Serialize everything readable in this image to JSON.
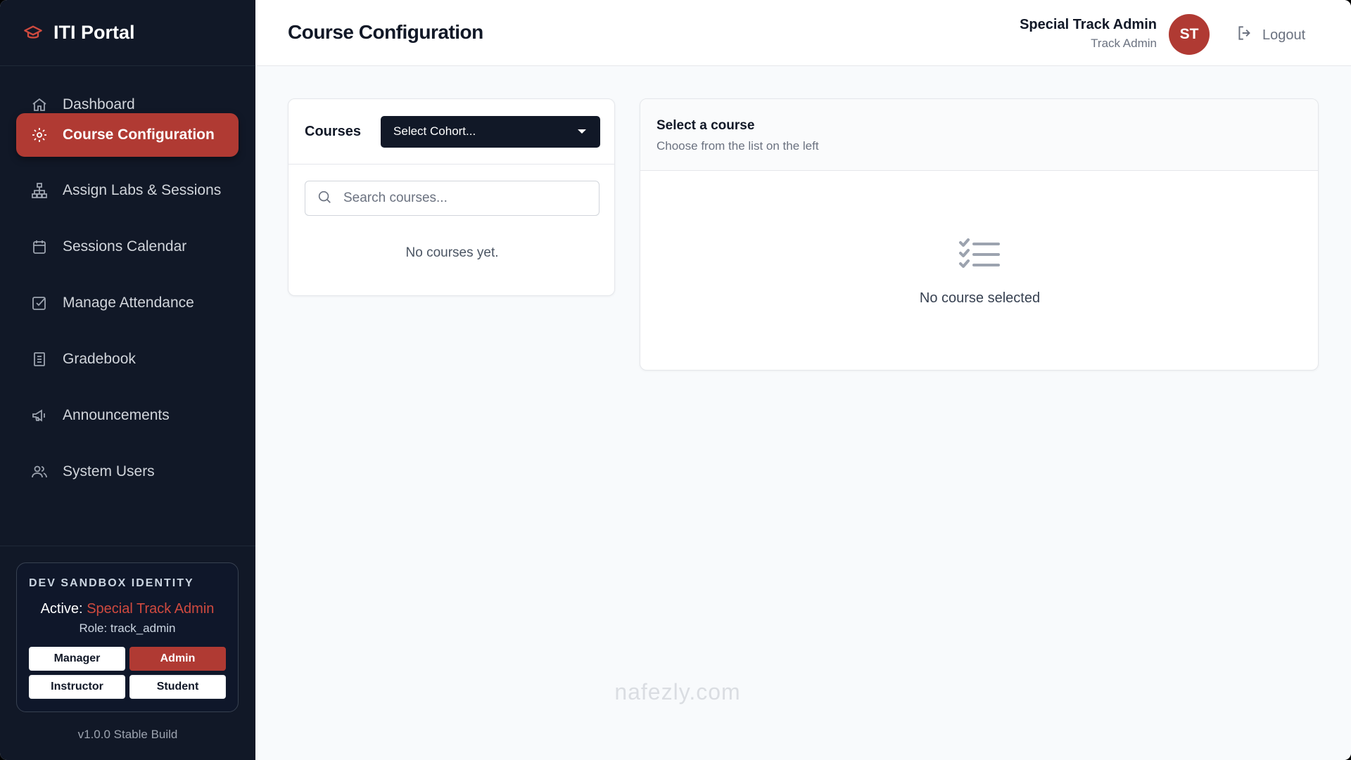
{
  "brand": {
    "title": "ITI Portal",
    "icon": "graduation-cap-icon"
  },
  "sidebar": {
    "items": [
      {
        "label": "Dashboard",
        "icon": "home-icon"
      },
      {
        "label": "Course Configuration",
        "icon": "gear-icon",
        "active": true
      },
      {
        "label": "Assign Labs & Sessions",
        "icon": "hierarchy-icon"
      },
      {
        "label": "Sessions Calendar",
        "icon": "calendar-icon"
      },
      {
        "label": "Manage Attendance",
        "icon": "check-square-icon"
      },
      {
        "label": "Gradebook",
        "icon": "book-icon"
      },
      {
        "label": "Announcements",
        "icon": "megaphone-icon"
      },
      {
        "label": "System Users",
        "icon": "users-icon"
      }
    ]
  },
  "sandbox": {
    "title": "DEV SANDBOX IDENTITY",
    "active_label": "Active:",
    "active_name": "Special Track Admin",
    "role_text": "Role: track_admin",
    "roles": [
      {
        "label": "Manager",
        "active": false
      },
      {
        "label": "Admin",
        "active": true
      },
      {
        "label": "Instructor",
        "active": false
      },
      {
        "label": "Student",
        "active": false
      }
    ]
  },
  "version": "v1.0.0 Stable Build",
  "header": {
    "title": "Course Configuration",
    "user_name": "Special Track Admin",
    "user_role": "Track Admin",
    "avatar_initials": "ST",
    "logout_label": "Logout"
  },
  "courses_panel": {
    "label": "Courses",
    "cohort_select": "Select Cohort...",
    "search_placeholder": "Search courses...",
    "empty_text": "No courses yet."
  },
  "detail_panel": {
    "title": "Select a course",
    "subtitle": "Choose from the list on the left",
    "empty_text": "No course selected",
    "empty_icon": "checklist-icon"
  },
  "watermark": "nafezly.com",
  "colors": {
    "sidebar_bg": "#111827",
    "accent": "#b03a33",
    "accent_text": "#d04a3f"
  }
}
